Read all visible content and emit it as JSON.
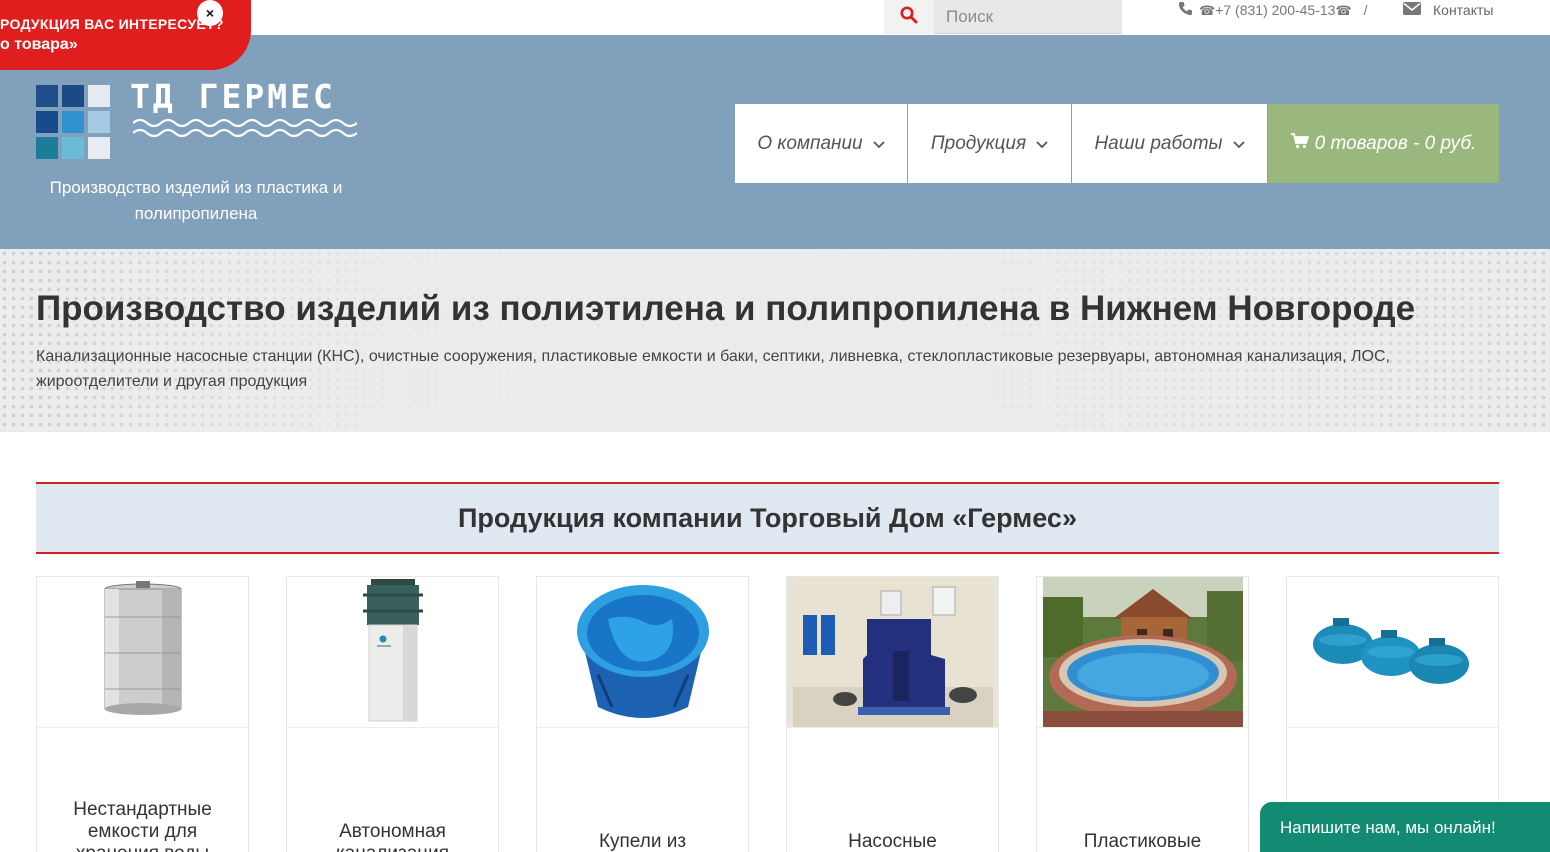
{
  "promo": {
    "line1": "РОДУКЦИЯ ВАС ИНТЕРЕСУЕТ?",
    "line2": "о товара»",
    "close": "×"
  },
  "topbar": {
    "search_placeholder": "Поиск",
    "phone": "+7 (831) 200-45-13",
    "separator": "/",
    "contacts": "Контакты"
  },
  "logo": {
    "name": "ТД ГЕРМЕС",
    "tagline": "Производство изделий из пластика и полипропилена",
    "colors": [
      "#2a5fa0",
      "#1f5491",
      "#ffffff",
      "#1a4e8f",
      "#2e92d0",
      "#a9cbe6",
      "#1f7d96",
      "#6bbad8",
      "#e8eef3"
    ]
  },
  "nav": {
    "items": [
      {
        "label": "О компании"
      },
      {
        "label": "Продукция"
      },
      {
        "label": "Наши работы"
      }
    ],
    "cart": "0 товаров - 0 руб."
  },
  "hero": {
    "title": "Производство изделий из полиэтилена и полипропилена в Нижнем Новгороде",
    "subtitle": "Канализационные насосные станции (КНС), очистные сооружения, пластиковые емкости и баки, септики, ливневка, стеклопластиковые резервуары, автономная канализация, ЛОС, жироотделители и другая продукция"
  },
  "products": {
    "title": "Продукция компании Торговый Дом «Гермес»",
    "items": [
      {
        "title": "Нестандартные емкости для хранения воды"
      },
      {
        "title": "Автономная канализация"
      },
      {
        "title": "Купели из"
      },
      {
        "title": "Насосные"
      },
      {
        "title": "Пластиковые"
      },
      {
        "title": ""
      }
    ]
  },
  "chat": {
    "label": "Напишите нам, мы онлайн!"
  },
  "colors": {
    "header_bg": "#81a0bb",
    "cart_bg": "#9ab87e",
    "accent_red": "#d42020",
    "section_bg": "#e0e8f2",
    "chat_bg": "#138a72"
  }
}
